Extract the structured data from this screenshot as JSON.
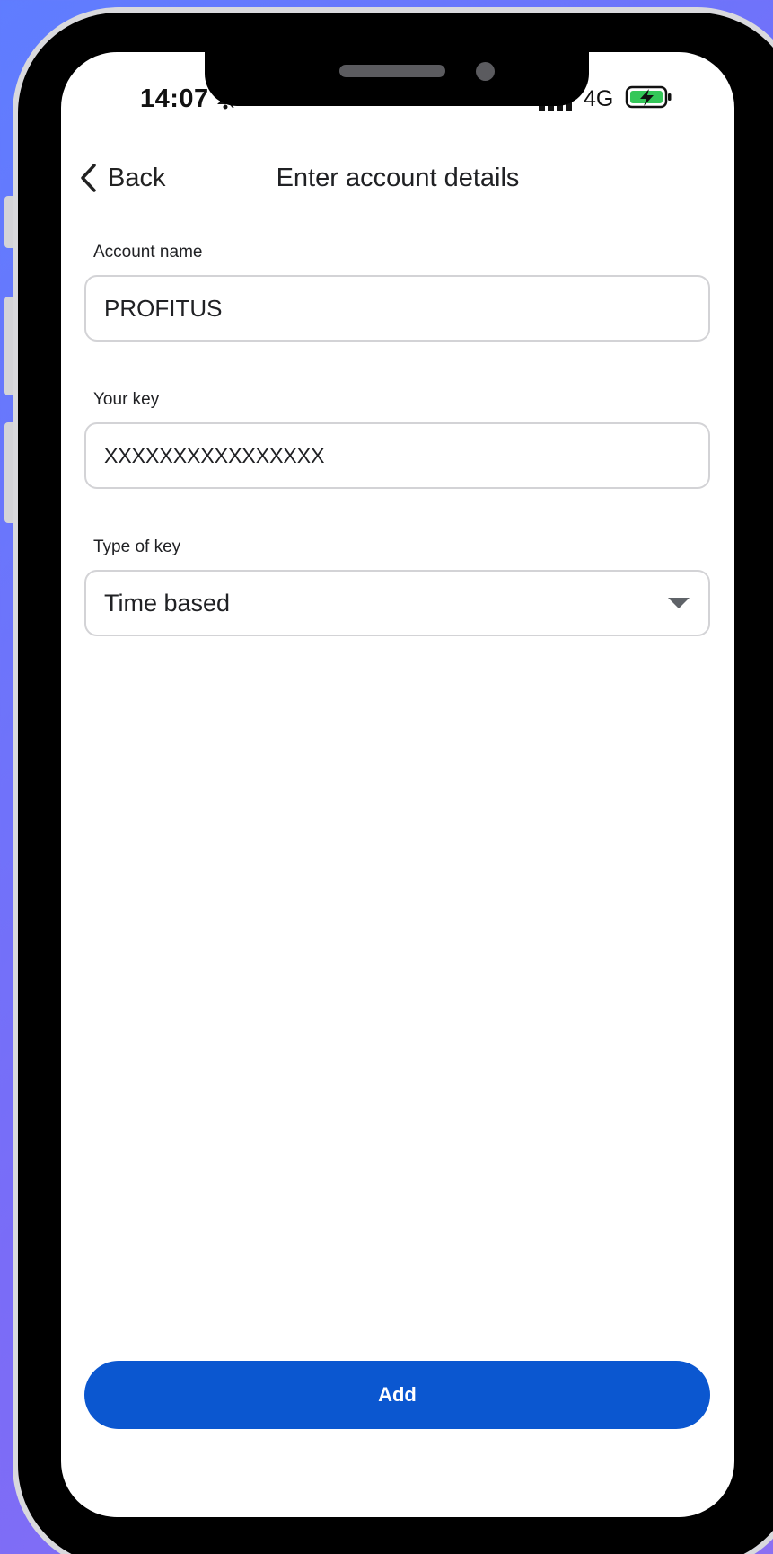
{
  "status_bar": {
    "time": "14:07",
    "network": "4G",
    "bell_icon": "bell-muted-icon",
    "signal_icon": "signal-bars-icon",
    "battery_icon": "battery-charging-icon"
  },
  "nav": {
    "back_label": "Back",
    "back_icon": "chevron-left-icon",
    "title": "Enter account details"
  },
  "form": {
    "account_name": {
      "label": "Account name",
      "value": "PROFITUS"
    },
    "key": {
      "label": "Your key",
      "value": "XXXXXXXXXXXXXXXX"
    },
    "key_type": {
      "label": "Type of key",
      "selected": "Time based",
      "dropdown_icon": "caret-down-icon"
    }
  },
  "actions": {
    "add_label": "Add"
  },
  "colors": {
    "primary": "#0b57d0",
    "background_gradient_start": "#5f7dff",
    "background_gradient_end": "#8b6ff2"
  }
}
